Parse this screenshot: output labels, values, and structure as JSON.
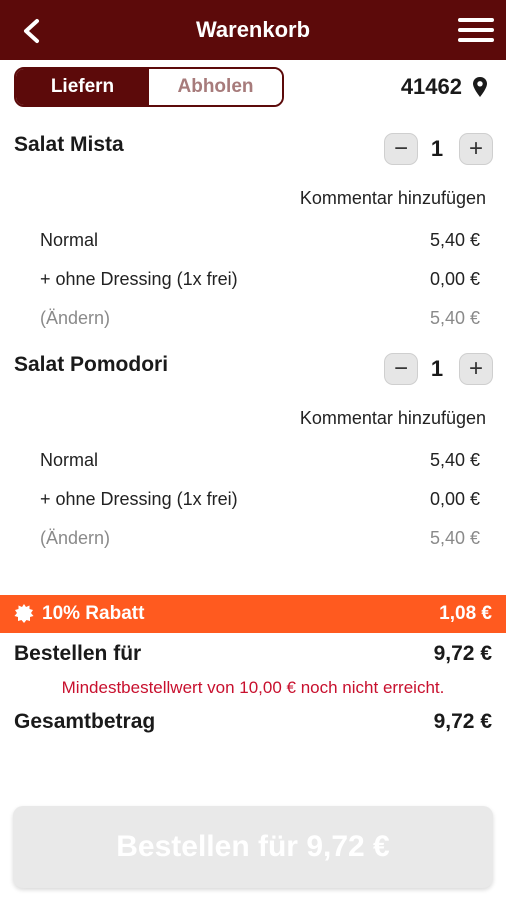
{
  "header": {
    "title": "Warenkorb"
  },
  "delivery_toggle": {
    "deliver_label": "Liefern",
    "pickup_label": "Abholen",
    "active": "Liefern"
  },
  "postcode": "41462",
  "items": [
    {
      "name": "Salat Mista",
      "quantity": "1",
      "minus": "−",
      "plus": "+",
      "comment_label": "Kommentar hinzufügen",
      "options": [
        {
          "label": "Normal",
          "price": "5,40 €"
        },
        {
          "label": "+ ohne Dressing (1x frei)",
          "price": "0,00 €"
        },
        {
          "label": "(Ändern)",
          "price": "5,40 €"
        }
      ]
    },
    {
      "name": "Salat Pomodori",
      "quantity": "1",
      "minus": "−",
      "plus": "+",
      "comment_label": "Kommentar hinzufügen",
      "options": [
        {
          "label": "Normal",
          "price": "5,40 €"
        },
        {
          "label": "+ ohne Dressing (1x frei)",
          "price": "0,00 €"
        },
        {
          "label": "(Ändern)",
          "price": "5,40 €"
        }
      ]
    }
  ],
  "discount": {
    "label": "10% Rabatt",
    "amount": "1,08 €"
  },
  "summary": {
    "order_for_label": "Bestellen für",
    "order_for_value": "9,72 €",
    "warning": "Mindestbestellwert von 10,00 € noch nicht erreicht.",
    "total_label": "Gesamtbetrag",
    "total_value": "9,72 €"
  },
  "order_button": {
    "label": "Bestellen für 9,72 €"
  },
  "colors": {
    "brand": "#5c0a0a",
    "discount": "#ff5a1f",
    "warning": "#c8102e",
    "disabled_button": "#e9e9e9"
  }
}
